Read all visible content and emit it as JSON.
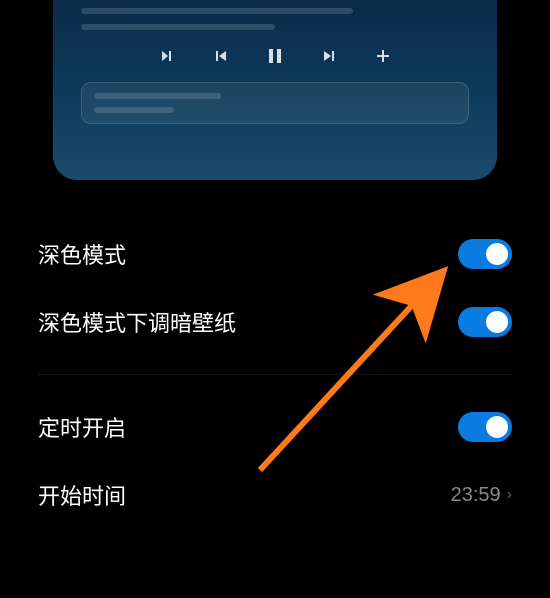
{
  "preview": {
    "media_controls": [
      "rewind",
      "previous",
      "pause",
      "next",
      "add"
    ]
  },
  "settings": {
    "dark_mode": {
      "label": "深色模式",
      "enabled": true
    },
    "dim_wallpaper": {
      "label": "深色模式下调暗壁纸",
      "enabled": true
    },
    "scheduled": {
      "label": "定时开启",
      "enabled": true
    },
    "start_time": {
      "label": "开始时间",
      "value": "23:59"
    }
  },
  "annotation": {
    "type": "arrow",
    "color": "#ff7a1a",
    "points_to": "dark_mode_toggle"
  }
}
